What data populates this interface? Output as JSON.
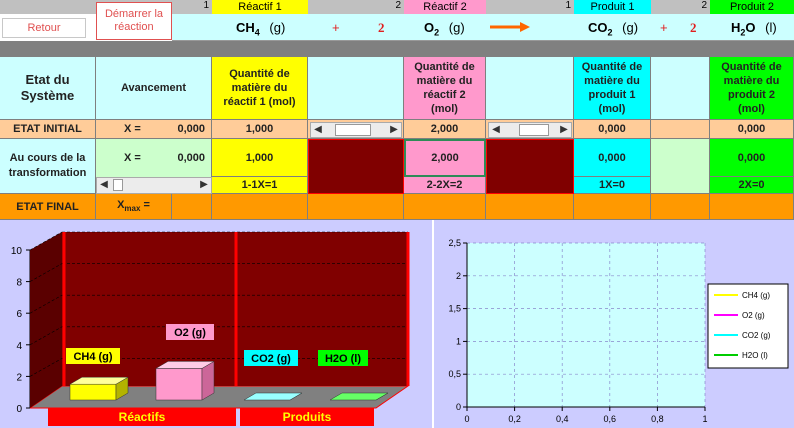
{
  "buttons": {
    "retour": "Retour",
    "demarrer": "Démarrer la réaction"
  },
  "header": {
    "numbers": [
      "1",
      "2",
      "1",
      "2"
    ],
    "reactif1": "Réactif 1",
    "reactif2": "Réactif 2",
    "produit1": "Produit 1",
    "produit2": "Produit 2"
  },
  "equation": {
    "ch4_base": "CH",
    "ch4_sub": "4",
    "ch4_state": "(g)",
    "plus1": "+",
    "coef_o2": "2",
    "o2_base": "O",
    "o2_sub": "2",
    "o2_state": "(g)",
    "co2_base": "CO",
    "co2_sub": "2",
    "co2_state": "(g)",
    "plus2": "+",
    "coef_h2o": "2",
    "h2o_base": "H",
    "h2o_sub": "2",
    "h2o_base2": "O",
    "h2o_state": "(l)"
  },
  "table": {
    "etat_systeme": "Etat du Système",
    "avancement": "Avancement",
    "q_reactif1": "Quantité de matière du réactif 1 (mol)",
    "q_reactif2": "Quantité de matière du réactif 2 (mol)",
    "q_produit1": "Quantité de matière du produit 1 (mol)",
    "q_produit2": "Quantité de matière du produit 2 (mol)",
    "etat_initial": "ETAT INITIAL",
    "x_label": "X =",
    "x_initial": "0,000",
    "init_r1": "1,000",
    "init_r2": "2,000",
    "init_p1": "0,000",
    "init_p2": "0,000",
    "au_cours": "Au cours de la transformation",
    "x_cours": "0,000",
    "cours_r1": "1,000",
    "cours_r2": "2,000",
    "cours_p1": "0,000",
    "cours_p2": "0,000",
    "expr_r1": "1-1X=1",
    "expr_r2": "2-2X=2",
    "expr_p1": "1X=0",
    "expr_p2": "2X=0",
    "etat_final": "ETAT FINAL",
    "xmax_base": "X",
    "xmax_sub": "max",
    "xmax_eq": "="
  },
  "bar_chart": {
    "y_ticks": [
      "0",
      "2",
      "4",
      "6",
      "8",
      "10"
    ],
    "group_reactifs": "Réactifs",
    "group_produits": "Produits",
    "labels": {
      "ch4": "CH4 (g)",
      "o2": "O2 (g)",
      "co2": "CO2 (g)",
      "h2o": "H2O (l)"
    }
  },
  "chart_data": {
    "type": "line",
    "x_ticks": [
      "0",
      "0,2",
      "0,4",
      "0,6",
      "0,8",
      "1"
    ],
    "y_ticks": [
      "0",
      "0,5",
      "1",
      "1,5",
      "2",
      "2,5"
    ],
    "xlim": [
      0,
      1
    ],
    "ylim": [
      0,
      2.5
    ],
    "grid": true,
    "legend_position": "right",
    "series": [
      {
        "name": "CH4 (g)",
        "color": "#ffff00",
        "values": []
      },
      {
        "name": "O2 (g)",
        "color": "#ff00ff",
        "values": []
      },
      {
        "name": "CO2 (g)",
        "color": "#00ffff",
        "values": []
      },
      {
        "name": "H2O (l)",
        "color": "#00cc00",
        "values": []
      }
    ]
  },
  "colors": {
    "header_cyan": "#ccffff",
    "yellow": "#ffff00",
    "pink": "#ff99cc",
    "cyan": "#00ffff",
    "green": "#00ff00",
    "orange": "#ff9900",
    "peach": "#ffcc99",
    "darkred": "#800000",
    "chart_bg": "#ccccff"
  }
}
